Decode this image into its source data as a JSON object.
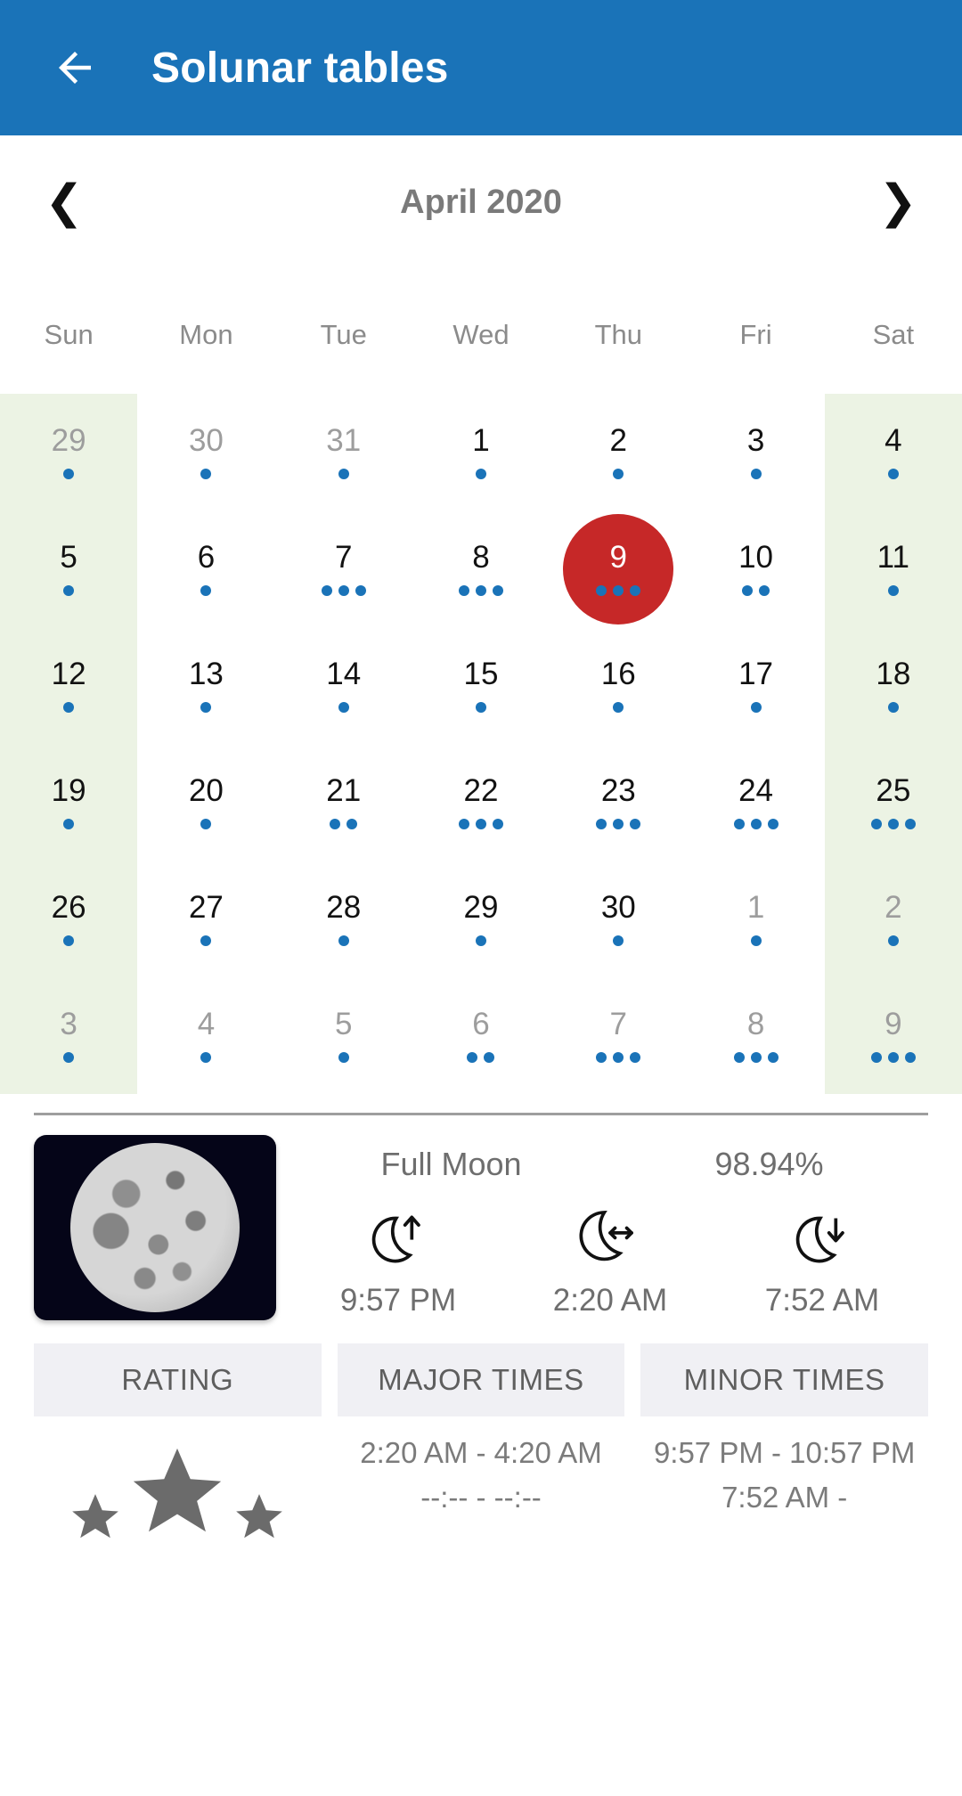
{
  "appbar": {
    "title": "Solunar tables",
    "back_icon": "arrow-left-icon",
    "bg_color": "#1a73b8"
  },
  "calendar": {
    "month_label": "April 2020",
    "prev_icon": "chevron-left-icon",
    "next_icon": "chevron-right-icon",
    "weekdays": [
      "Sun",
      "Mon",
      "Tue",
      "Wed",
      "Thu",
      "Fri",
      "Sat"
    ],
    "selected_day": 9,
    "selected_color": "#c62828",
    "dot_color": "#1a73b8",
    "weekend_bg": "#ecf3e4",
    "weeks": [
      [
        {
          "day": "29",
          "dots": 1,
          "muted": true,
          "weekend": true
        },
        {
          "day": "30",
          "dots": 1,
          "muted": true,
          "weekend": false
        },
        {
          "day": "31",
          "dots": 1,
          "muted": true,
          "weekend": false
        },
        {
          "day": "1",
          "dots": 1,
          "muted": false,
          "weekend": false
        },
        {
          "day": "2",
          "dots": 1,
          "muted": false,
          "weekend": false
        },
        {
          "day": "3",
          "dots": 1,
          "muted": false,
          "weekend": false
        },
        {
          "day": "4",
          "dots": 1,
          "muted": false,
          "weekend": true
        }
      ],
      [
        {
          "day": "5",
          "dots": 1,
          "muted": false,
          "weekend": true
        },
        {
          "day": "6",
          "dots": 1,
          "muted": false,
          "weekend": false
        },
        {
          "day": "7",
          "dots": 3,
          "muted": false,
          "weekend": false
        },
        {
          "day": "8",
          "dots": 3,
          "muted": false,
          "weekend": false
        },
        {
          "day": "9",
          "dots": 3,
          "muted": false,
          "weekend": false,
          "selected": true
        },
        {
          "day": "10",
          "dots": 2,
          "muted": false,
          "weekend": false
        },
        {
          "day": "11",
          "dots": 1,
          "muted": false,
          "weekend": true
        }
      ],
      [
        {
          "day": "12",
          "dots": 1,
          "muted": false,
          "weekend": true
        },
        {
          "day": "13",
          "dots": 1,
          "muted": false,
          "weekend": false
        },
        {
          "day": "14",
          "dots": 1,
          "muted": false,
          "weekend": false
        },
        {
          "day": "15",
          "dots": 1,
          "muted": false,
          "weekend": false
        },
        {
          "day": "16",
          "dots": 1,
          "muted": false,
          "weekend": false
        },
        {
          "day": "17",
          "dots": 1,
          "muted": false,
          "weekend": false
        },
        {
          "day": "18",
          "dots": 1,
          "muted": false,
          "weekend": true
        }
      ],
      [
        {
          "day": "19",
          "dots": 1,
          "muted": false,
          "weekend": true
        },
        {
          "day": "20",
          "dots": 1,
          "muted": false,
          "weekend": false
        },
        {
          "day": "21",
          "dots": 2,
          "muted": false,
          "weekend": false
        },
        {
          "day": "22",
          "dots": 3,
          "muted": false,
          "weekend": false
        },
        {
          "day": "23",
          "dots": 3,
          "muted": false,
          "weekend": false
        },
        {
          "day": "24",
          "dots": 3,
          "muted": false,
          "weekend": false
        },
        {
          "day": "25",
          "dots": 3,
          "muted": false,
          "weekend": true
        }
      ],
      [
        {
          "day": "26",
          "dots": 1,
          "muted": false,
          "weekend": true
        },
        {
          "day": "27",
          "dots": 1,
          "muted": false,
          "weekend": false
        },
        {
          "day": "28",
          "dots": 1,
          "muted": false,
          "weekend": false
        },
        {
          "day": "29",
          "dots": 1,
          "muted": false,
          "weekend": false
        },
        {
          "day": "30",
          "dots": 1,
          "muted": false,
          "weekend": false
        },
        {
          "day": "1",
          "dots": 1,
          "muted": true,
          "weekend": false
        },
        {
          "day": "2",
          "dots": 1,
          "muted": true,
          "weekend": true
        }
      ],
      [
        {
          "day": "3",
          "dots": 1,
          "muted": true,
          "weekend": true
        },
        {
          "day": "4",
          "dots": 1,
          "muted": true,
          "weekend": false
        },
        {
          "day": "5",
          "dots": 1,
          "muted": true,
          "weekend": false
        },
        {
          "day": "6",
          "dots": 2,
          "muted": true,
          "weekend": false
        },
        {
          "day": "7",
          "dots": 3,
          "muted": true,
          "weekend": false
        },
        {
          "day": "8",
          "dots": 3,
          "muted": true,
          "weekend": false
        },
        {
          "day": "9",
          "dots": 3,
          "muted": true,
          "weekend": true
        }
      ]
    ]
  },
  "moon": {
    "image_alt": "full-moon-photo",
    "phase": "Full Moon",
    "illumination": "98.94%",
    "events": [
      {
        "icon": "moonrise-icon",
        "time": "9:57 PM"
      },
      {
        "icon": "moon-transit-icon",
        "time": "2:20 AM"
      },
      {
        "icon": "moonset-icon",
        "time": "7:52 AM"
      }
    ]
  },
  "tables": {
    "rating": {
      "header": "RATING",
      "stars_filled": 3,
      "star_icon": "star-icon"
    },
    "major": {
      "header": "MAJOR TIMES",
      "rows": [
        "2:20 AM - 4:20 AM",
        "--:-- - --:--"
      ]
    },
    "minor": {
      "header": "MINOR TIMES",
      "rows": [
        "9:57 PM - 10:57 PM",
        "7:52 AM -"
      ]
    }
  }
}
